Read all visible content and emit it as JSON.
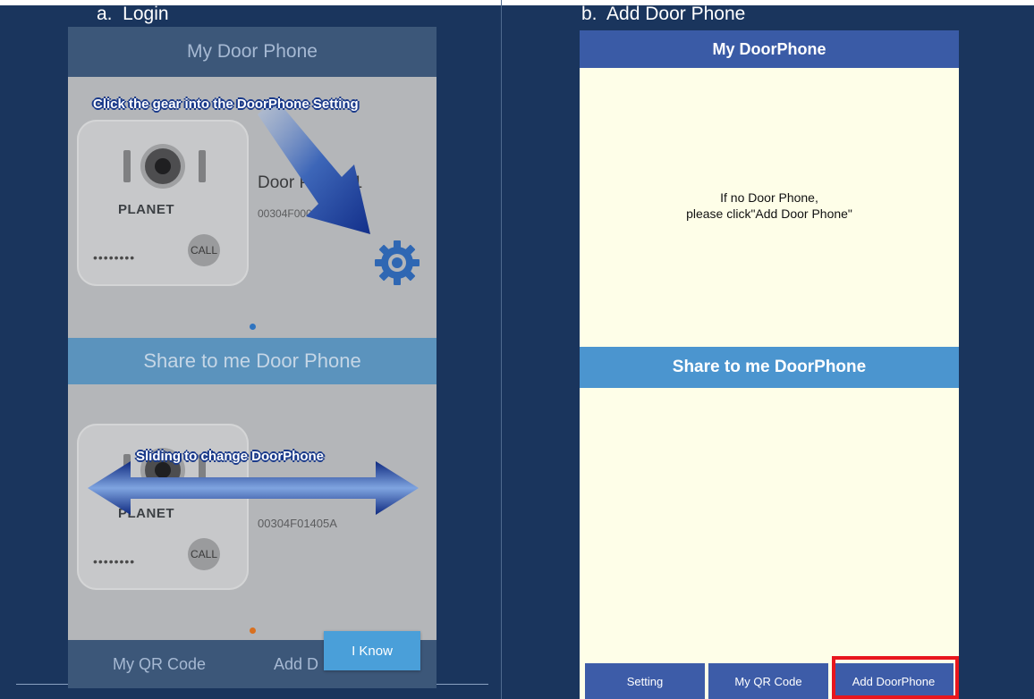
{
  "captions": {
    "a": "a.  Login",
    "b": "b.  Add Door Phone"
  },
  "panel_a": {
    "header_title": "My Door Phone",
    "hint_gear": "Click the gear into the DoorPhone Setting",
    "hint_slide": "Sliding to change DoorPhone",
    "card1": {
      "brand": "PLANET",
      "dots": "••••••••",
      "call": "CALL",
      "name": "Door Phone 1",
      "mac": "00304F000"
    },
    "card2": {
      "brand": "PLANET",
      "dots": "••••••••",
      "call": "CALL",
      "mac": "00304F01405A"
    },
    "share_title": "Share to me Door Phone",
    "tabs": [
      "My QR Code",
      "Add D"
    ],
    "know_button": "I Know",
    "colors": {
      "header": "#3c5779",
      "share": "#5b93bd",
      "button": "#4a9fd9",
      "arrow": "#1e3f9e"
    }
  },
  "panel_b": {
    "header_title": "My DoorPhone",
    "empty_line1": "If no Door Phone,",
    "empty_line2": "please click\"Add Door Phone\"",
    "share_title": "Share to me DoorPhone",
    "buttons": [
      "Setting",
      "My QR Code",
      "Add DoorPhone"
    ],
    "highlighted_button": "Add DoorPhone",
    "colors": {
      "header": "#3a5ba6",
      "share": "#4b95cf",
      "background": "#fefee8",
      "highlight": "#e8161d"
    }
  }
}
